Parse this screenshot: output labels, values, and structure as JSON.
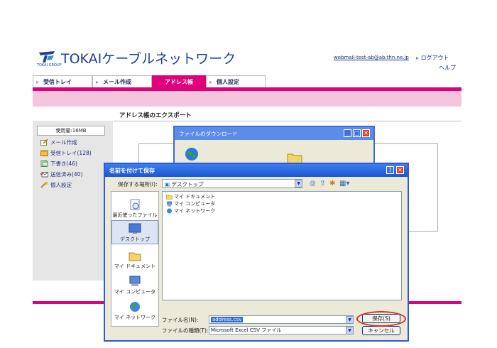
{
  "header": {
    "brand": "TOKAIケーブルネットワーク",
    "logo_group": "TOKAI GROUP",
    "user_email": "webmail-test-ab@ab.thn.ne.jp",
    "logout": "ログアウト",
    "help": "ヘルプ"
  },
  "tabs": [
    {
      "label": "受信トレイ",
      "active": false
    },
    {
      "label": "メール作成",
      "active": false
    },
    {
      "label": "アドレス帳",
      "active": true
    },
    {
      "label": "個人設定",
      "active": false
    }
  ],
  "page_title": "アドレス帳のエクスポート",
  "sidebar": {
    "usage": "使用量:16MB",
    "items": [
      {
        "label": "メール作成",
        "icon": "compose-icon"
      },
      {
        "label": "受信トレイ(128)",
        "icon": "inbox-icon"
      },
      {
        "label": "下書き(46)",
        "icon": "draft-icon"
      },
      {
        "label": "送信済み(40)",
        "icon": "sent-icon"
      },
      {
        "label": "個人設定",
        "icon": "settings-icon"
      }
    ]
  },
  "download_window": {
    "title": "ファイルのダウンロード"
  },
  "save_dialog": {
    "title": "名前を付けて保存",
    "save_in_label": "保存する場所(I):",
    "save_in_value": "デスクトップ",
    "places": [
      {
        "label": "最近使ったファイル",
        "icon": "recent-icon"
      },
      {
        "label": "デスクトップ",
        "icon": "desktop-icon"
      },
      {
        "label": "マイ ドキュメント",
        "icon": "documents-icon"
      },
      {
        "label": "マイ コンピュータ",
        "icon": "computer-icon"
      },
      {
        "label": "マイ ネットワーク",
        "icon": "network-icon"
      }
    ],
    "files": [
      {
        "label": "マイ ドキュメント",
        "icon": "folder-icon"
      },
      {
        "label": "マイ コンピュータ",
        "icon": "computer-icon"
      },
      {
        "label": "マイ ネットワーク",
        "icon": "network-icon"
      }
    ],
    "filename_label": "ファイル名(N):",
    "filename_value": "address.csv",
    "filetype_label": "ファイルの種類(T):",
    "filetype_value": "Microsoft Excel CSV ファイル",
    "save_button": "保存(S)",
    "cancel_button": "キャンセル"
  },
  "colors": {
    "accent_pink": "#e0007c",
    "brand_blue": "#1f3f9a",
    "xp_title_blue": "#2e5ad6",
    "highlight_red": "#d23030"
  }
}
